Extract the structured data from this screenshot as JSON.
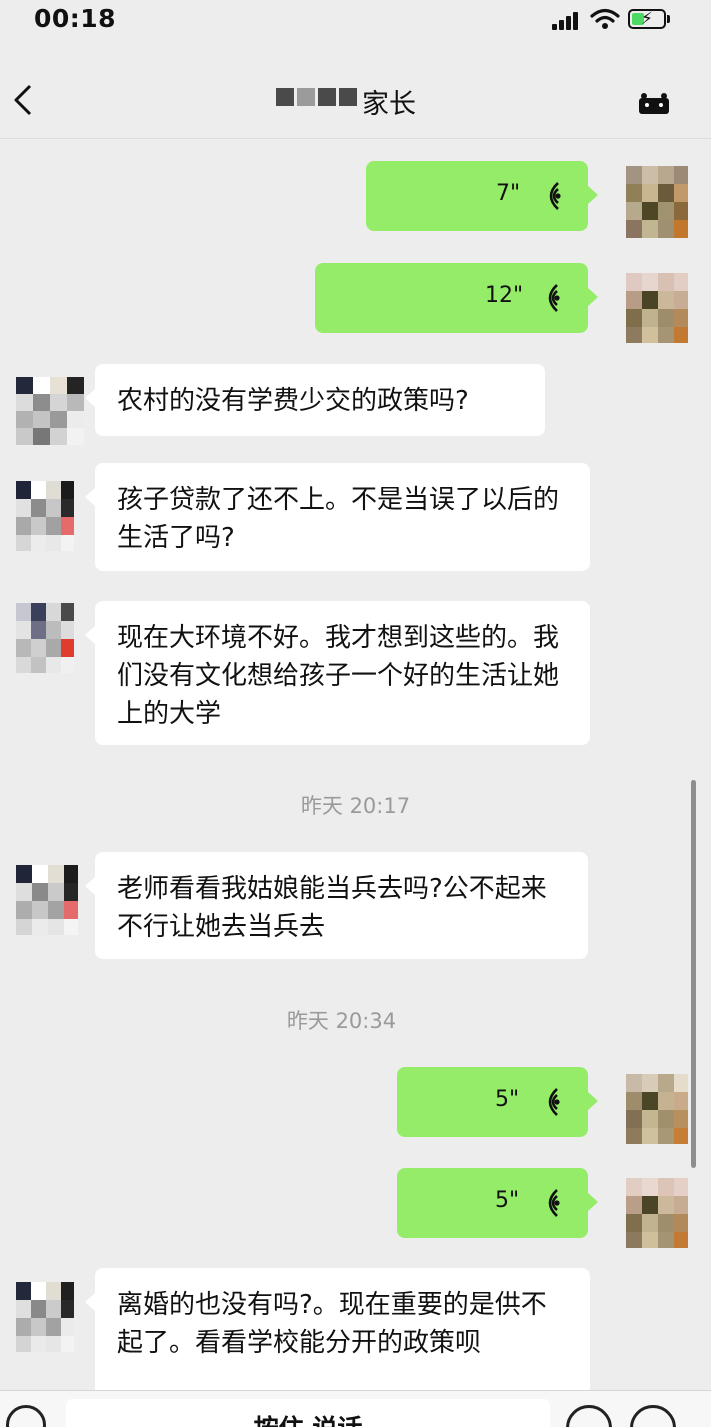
{
  "status_bar": {
    "time": "00:18"
  },
  "header": {
    "title": "家长"
  },
  "messages": {
    "out_1": {
      "duration": "7\""
    },
    "out_2": {
      "duration": "12\""
    },
    "in_1": {
      "text": "农村的没有学费少交的政策吗?"
    },
    "in_2": {
      "text": "孩子贷款了还不上。不是当误了以后的生活了吗?"
    },
    "in_3": {
      "text": "现在大环境不好。我才想到这些的。我们没有文化想给孩子一个好的生活让她上的大学"
    },
    "time_1": "昨天 20:17",
    "in_4": {
      "text": "老师看看我姑娘能当兵去吗?公不起来不行让她去当兵去"
    },
    "time_2": "昨天 20:34",
    "out_3": {
      "duration": "5\""
    },
    "out_4": {
      "duration": "5\""
    },
    "in_5": {
      "text": "离婚的也没有吗?。现在重要的是供不起了。看看学校能分开的政策呗"
    }
  },
  "input_bar": {
    "hold_to_talk": "按住 说话"
  },
  "colors": {
    "outgoing_bubble": "#95ec69",
    "incoming_bubble": "#ffffff",
    "background": "#ededed"
  },
  "icons": [
    "back-chevron-icon",
    "more-options-icon",
    "voice-wave-icon",
    "keyboard-icon",
    "emoji-icon",
    "plus-icon",
    "signal-icon",
    "wifi-icon",
    "battery-charging-icon"
  ]
}
